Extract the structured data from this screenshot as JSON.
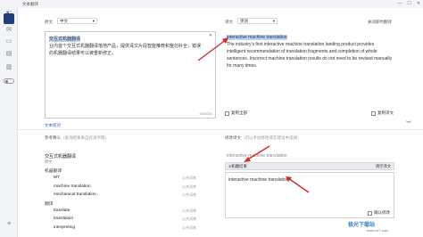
{
  "window": {
    "title": "文本翻译"
  },
  "source": {
    "lang_label": "原文",
    "lang_value": "中文",
    "text_title": "交互式机器翻译",
    "text_body": "业内首个交互式机器翻译落地产品，提供译文片段智能推荐和整句补全，错误的机器翻译结果可以被重新修正。",
    "count": "60/5000"
  },
  "target": {
    "lang_label": "译文",
    "lang_value": "英语",
    "close_link": "关闭即时翻译",
    "text_title": "interactive machine translation",
    "text_body": "The industry's first interactive machine translation landing product provides intelligent recommendation of translation fragments and completion of whole sentences. Incorrect machine translation results do not need to be revised manually for many times."
  },
  "source_copy": "复制全部",
  "target_copy": "复制译文",
  "file_link": "文本校对",
  "reference": {
    "header": "参考释义",
    "sub": "（查询结果来自有道字典）",
    "title": "交互式机器翻译",
    "rows": [
      {
        "kind": "head",
        "text": "原文"
      },
      {
        "kind": "cat",
        "text": "机器翻译"
      },
      {
        "kind": "item",
        "text": "MT",
        "src": "公共词库"
      },
      {
        "kind": "item",
        "text": "machine translation",
        "src": "公共词库"
      },
      {
        "kind": "item",
        "text": "mechanical translation",
        "src": "公共词库"
      },
      {
        "kind": "cat",
        "text": "翻译"
      },
      {
        "kind": "item",
        "text": "translate",
        "src": "公共词库"
      },
      {
        "kind": "item",
        "text": "translation",
        "src": "公共词库"
      },
      {
        "kind": "item",
        "text": "interpreting",
        "src": "公共词库"
      }
    ]
  },
  "edit": {
    "header": "修改译文",
    "sub": "（可以手动修改或在建议中选择）",
    "title_value": "interactive machine translation",
    "btn_left": "1/机翻结果",
    "btn_right": "清空译文",
    "box_value": "interactive machine translation",
    "confirm": "确认修改"
  },
  "watermark": {
    "main": "极光下载站",
    "sub": "www.xz7.com"
  },
  "colors": {
    "accent": "#2e62c8",
    "arrow": "#d42a2a",
    "highlight": "#b8d4f6"
  },
  "icons": [
    "translate-icon",
    "folder-icon",
    "document-icon",
    "book-icon",
    "toggle-icon",
    "menu-icon"
  ]
}
